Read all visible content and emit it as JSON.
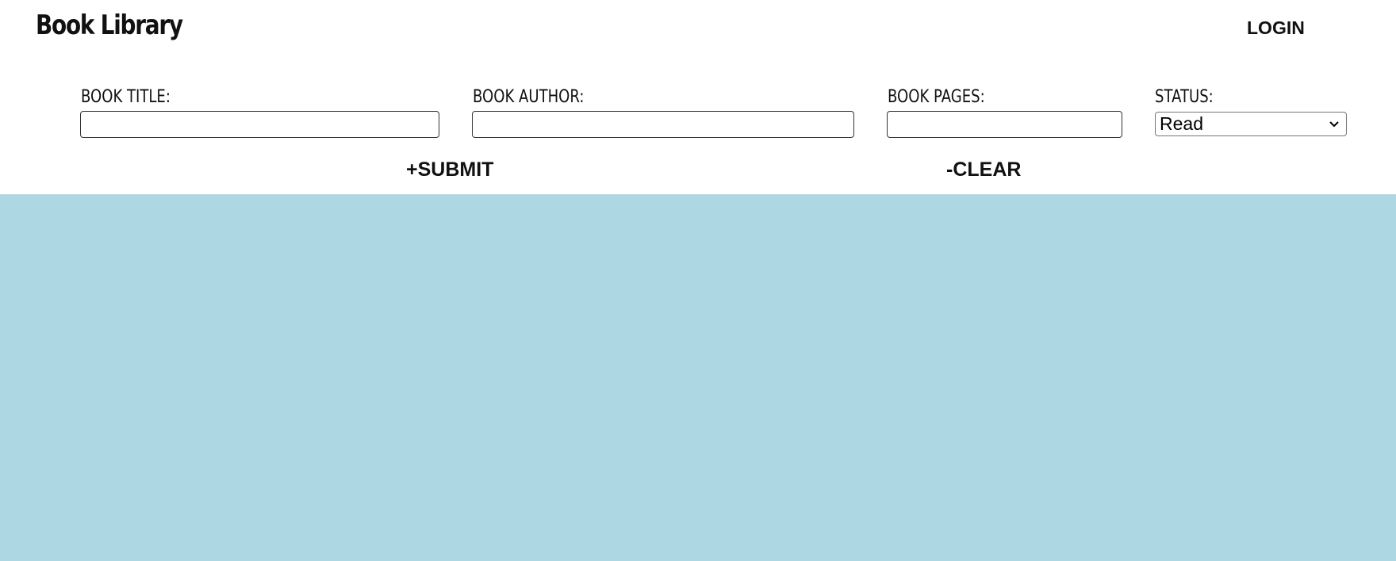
{
  "header": {
    "title": "Book Library",
    "login_label": "LOGIN"
  },
  "form": {
    "title_label": "BOOK TITLE:",
    "title_value": "",
    "author_label": "BOOK AUTHOR:",
    "author_value": "",
    "pages_label": "BOOK PAGES:",
    "pages_value": "",
    "status_label": "STATUS:",
    "status_value": "Read",
    "submit_label": "+SUBMIT",
    "clear_label": "-CLEAR"
  },
  "colors": {
    "content_background": "#add8e3",
    "header_background": "#ffffff"
  },
  "icons": {
    "status_dropdown": "chevron-down-icon"
  }
}
